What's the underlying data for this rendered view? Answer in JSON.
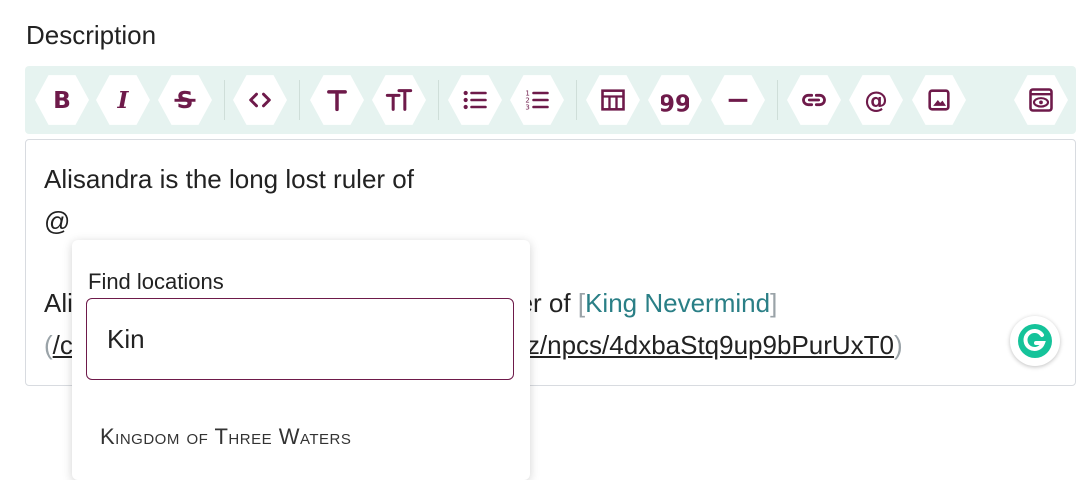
{
  "field_label": "Description",
  "colors": {
    "accent": "#6e1a4a",
    "toolbar_bg": "#e6f3f0",
    "link": "#2a7f86"
  },
  "toolbar": {
    "buttons": [
      "bold",
      "italic",
      "strikethrough",
      "code",
      "heading",
      "heading-smaller",
      "bulleted-list",
      "numbered-list",
      "table",
      "quote",
      "horizontal-rule",
      "link",
      "mention",
      "image",
      "preview"
    ]
  },
  "editor": {
    "line1": "Alisandra is the long lost ruler of",
    "line2": "@",
    "line3_left": "Ali",
    "line3_right": "nter of ",
    "link_open": "[",
    "link_label": "King Nevermind",
    "link_close": "]",
    "line4_open": "(",
    "line4_left": "/c",
    "line4_right": "z/npcs/4dxbaStq9up9bPurUxT0",
    "line4_close": ")"
  },
  "mention_popup": {
    "title": "Find locations",
    "query": "Kin",
    "results": [
      "Kingdom of Three Waters"
    ]
  }
}
